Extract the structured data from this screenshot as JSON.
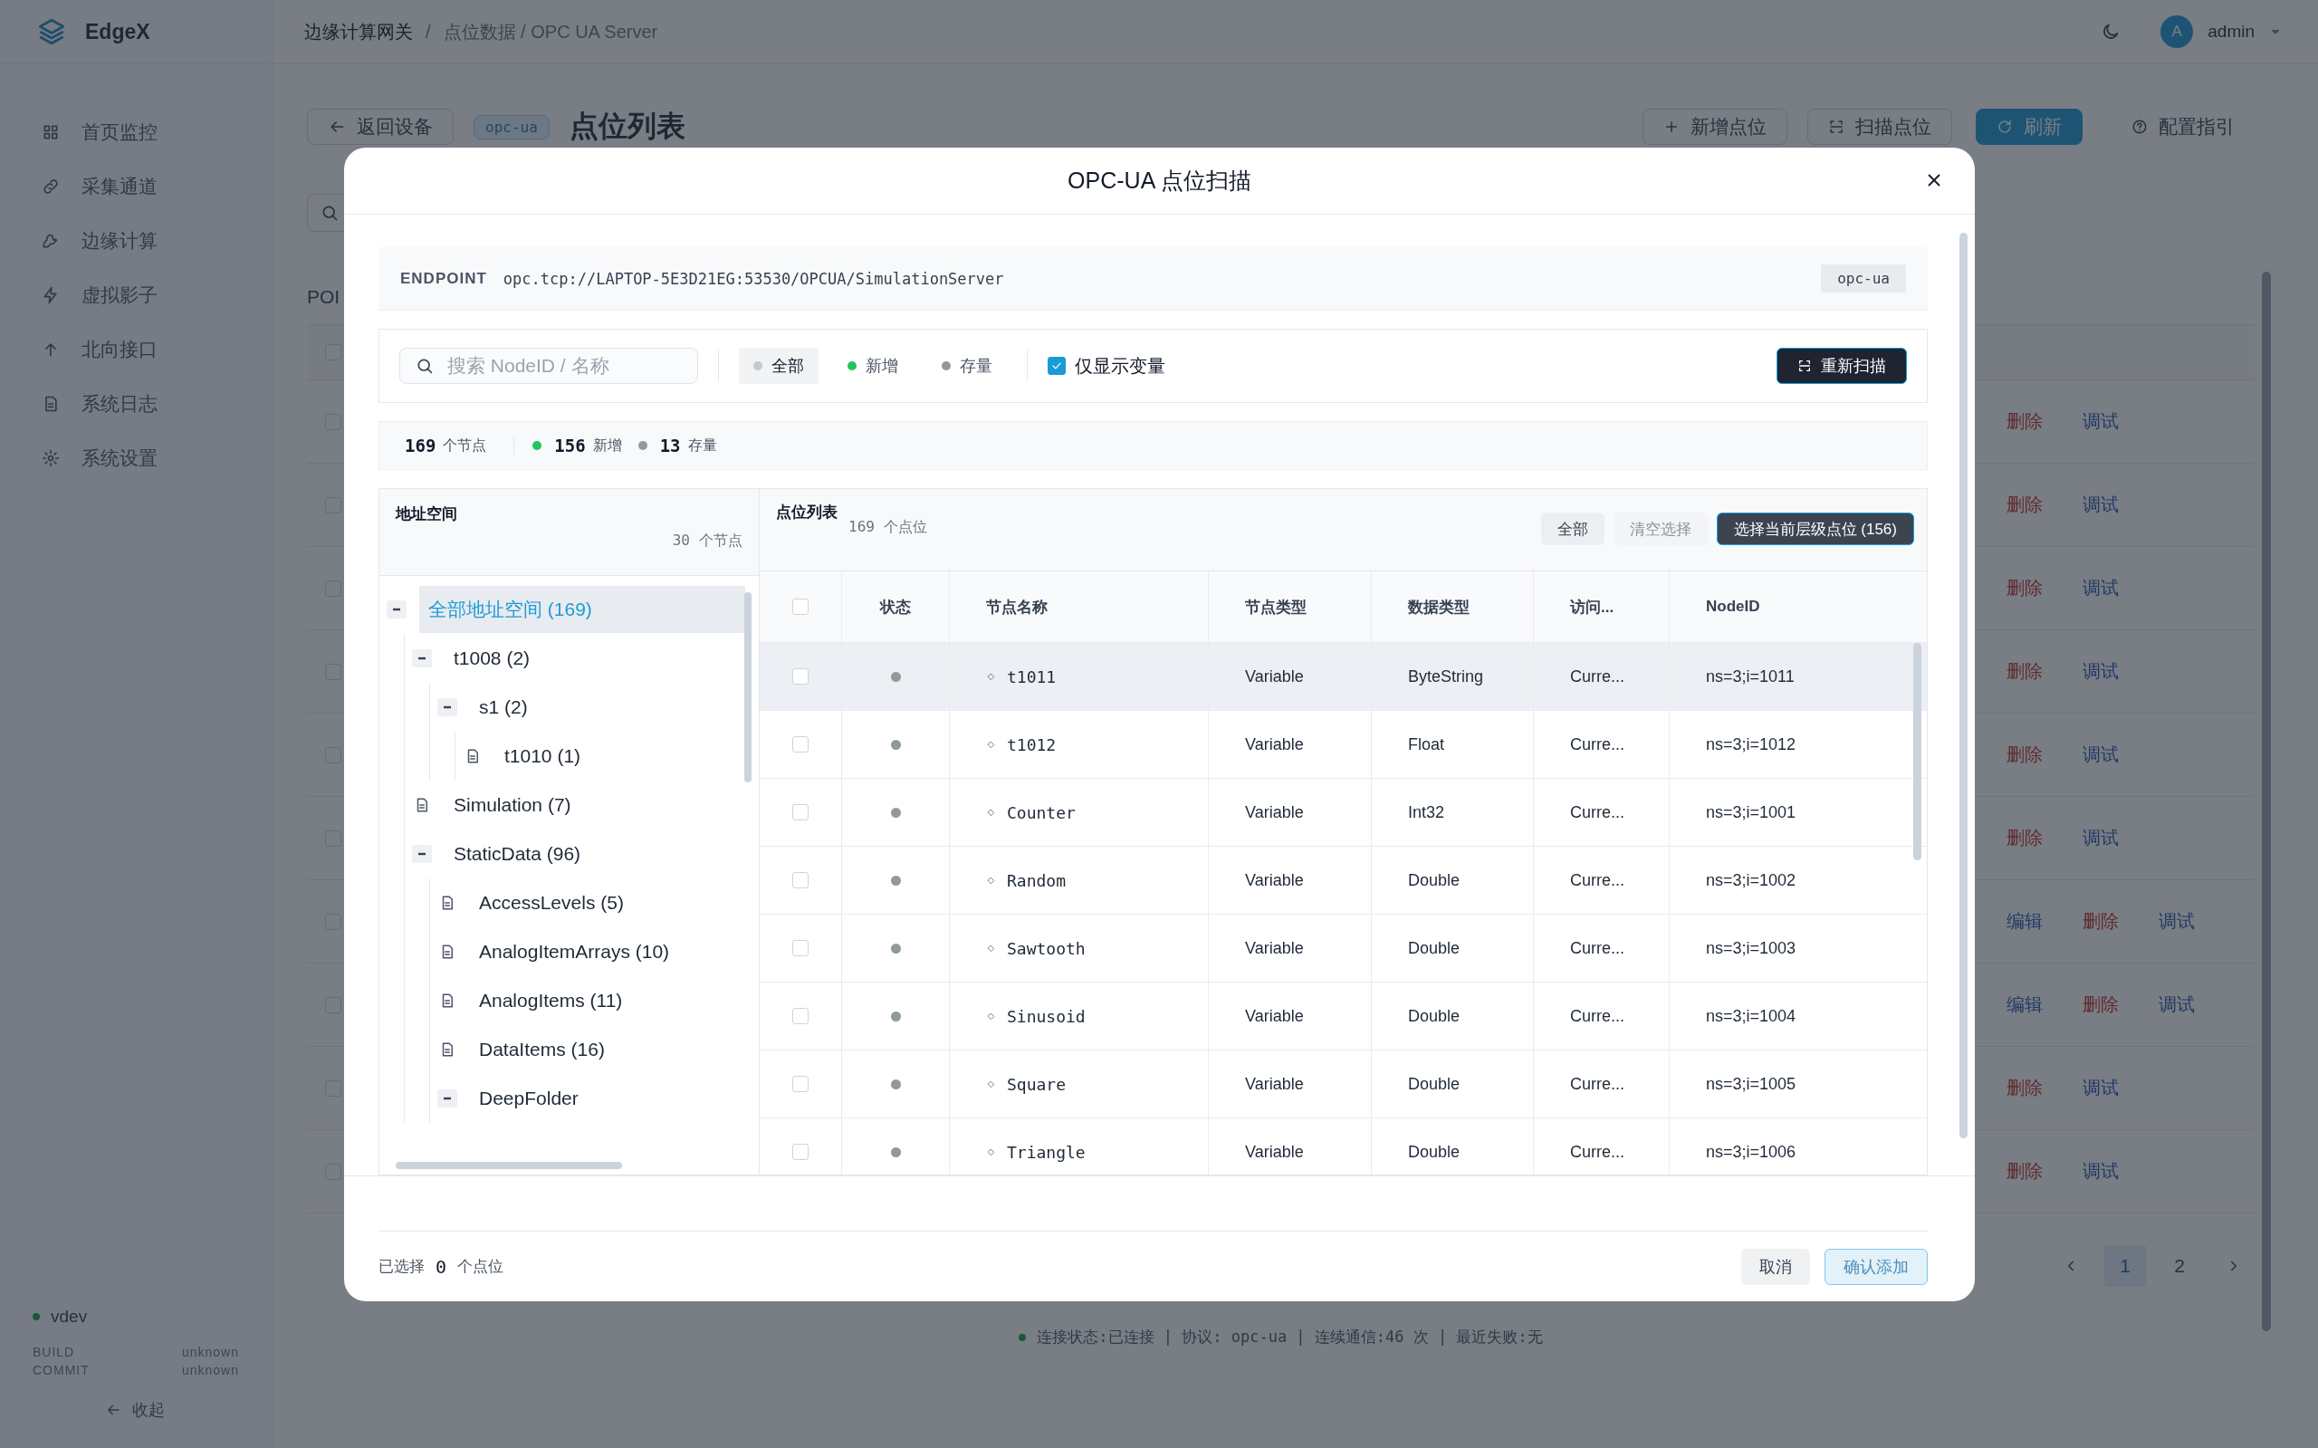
{
  "app": {
    "brand": "EdgeX"
  },
  "header": {
    "breadcrumb": [
      "边缘计算网关",
      "点位数据 / OPC UA Server"
    ],
    "breadcrumb_separator": "/",
    "user": {
      "avatar": "A",
      "name": "admin"
    }
  },
  "sidebar": {
    "items": [
      {
        "label": "首页监控",
        "selected": false
      },
      {
        "label": "采集通道",
        "selected": false
      },
      {
        "label": "边缘计算",
        "selected": false
      },
      {
        "label": "虚拟影子",
        "selected": false
      },
      {
        "label": "北向接口",
        "selected": false
      },
      {
        "label": "系统日志",
        "selected": false
      },
      {
        "label": "系统设置",
        "selected": false
      }
    ],
    "version": "vdev",
    "build": [
      {
        "label": "BUILD",
        "value": "unknown"
      },
      {
        "label": "COMMIT",
        "value": "unknown"
      }
    ],
    "collapse": "收起"
  },
  "page": {
    "back": "返回设备",
    "protocol_tag": "opc-ua",
    "title": "点位列表",
    "actions": [
      {
        "label": "新增点位",
        "kind": "add"
      },
      {
        "label": "扫描点位",
        "kind": "scan"
      },
      {
        "label": "刷新",
        "kind": "refresh"
      },
      {
        "label": "配置指引",
        "kind": "help"
      }
    ],
    "section_label": "POI",
    "table": {
      "all_checked": false,
      "rows": [
        {
          "checked": false,
          "actions": [
            {
              "label": "删除",
              "kind": "danger"
            },
            {
              "label": "调试",
              "kind": "link"
            }
          ]
        },
        {
          "checked": false,
          "actions": [
            {
              "label": "删除",
              "kind": "danger"
            },
            {
              "label": "调试",
              "kind": "link"
            }
          ]
        },
        {
          "checked": false,
          "actions": [
            {
              "label": "删除",
              "kind": "danger"
            },
            {
              "label": "调试",
              "kind": "link"
            }
          ]
        },
        {
          "checked": false,
          "actions": [
            {
              "label": "删除",
              "kind": "danger"
            },
            {
              "label": "调试",
              "kind": "link"
            }
          ]
        },
        {
          "checked": false,
          "actions": [
            {
              "label": "删除",
              "kind": "danger"
            },
            {
              "label": "调试",
              "kind": "link"
            }
          ]
        },
        {
          "checked": false,
          "actions": [
            {
              "label": "删除",
              "kind": "danger"
            },
            {
              "label": "调试",
              "kind": "link"
            }
          ]
        },
        {
          "checked": false,
          "actions": [
            {
              "label": "编辑",
              "kind": "link"
            },
            {
              "label": "删除",
              "kind": "danger"
            },
            {
              "label": "调试",
              "kind": "link"
            }
          ]
        },
        {
          "checked": false,
          "actions": [
            {
              "label": "编辑",
              "kind": "link"
            },
            {
              "label": "删除",
              "kind": "danger"
            },
            {
              "label": "调试",
              "kind": "link"
            }
          ]
        },
        {
          "checked": false,
          "actions": [
            {
              "label": "删除",
              "kind": "danger"
            },
            {
              "label": "调试",
              "kind": "link"
            }
          ]
        },
        {
          "checked": false,
          "actions": [
            {
              "label": "删除",
              "kind": "danger"
            },
            {
              "label": "调试",
              "kind": "link"
            }
          ]
        }
      ]
    },
    "pagination": [
      {
        "label": "1",
        "selected": true
      },
      {
        "label": "2",
        "selected": false
      }
    ],
    "status_line": "连接状态:已连接 | 协议: opc-ua | 连续通信:46 次 | 最近失败:无"
  },
  "modal": {
    "title": "OPC-UA 点位扫描",
    "endpoint": {
      "label": "ENDPOINT",
      "url": "opc.tcp://LAPTOP-5E3D21EG:53530/OPCUA/SimulationServer",
      "protocol": "opc-ua"
    },
    "search": {
      "placeholder": "搜索 NodeID / 名称"
    },
    "filters": [
      {
        "label": "全部",
        "selected": true,
        "color": "#c4c8cf"
      },
      {
        "label": "新增",
        "selected": false,
        "color": "#22c55e"
      },
      {
        "label": "存量",
        "selected": false,
        "color": "#8f9a9a"
      }
    ],
    "only_variables": {
      "label": "仅显示变量",
      "checked": true
    },
    "rescan": "重新扫描",
    "stats": {
      "total": "169",
      "total_unit": "个节点",
      "items": [
        {
          "value": "156",
          "label": "新增",
          "color": "#22c55e"
        },
        {
          "value": "13",
          "label": "存量",
          "color": "#8f9a9a"
        }
      ]
    },
    "tree": {
      "title": "地址空间",
      "count": "30",
      "count_unit": "个节点",
      "nodes": [
        {
          "label": "全部地址空间 (169)",
          "expanded": true,
          "selected": true,
          "children": [
            {
              "label": "t1008 (2)",
              "expanded": true,
              "selected": false,
              "children": [
                {
                  "label": "s1 (2)",
                  "expanded": true,
                  "selected": false,
                  "children": [
                    {
                      "label": "t1010 (1)",
                      "selected": false
                    }
                  ]
                }
              ]
            },
            {
              "label": "Simulation (7)",
              "selected": false
            },
            {
              "label": "StaticData (96)",
              "expanded": true,
              "selected": false,
              "children": [
                {
                  "label": "AccessLevels (5)",
                  "selected": false
                },
                {
                  "label": "AnalogItemArrays (10)",
                  "selected": false
                },
                {
                  "label": "AnalogItems (11)",
                  "selected": false
                },
                {
                  "label": "DataItems (16)",
                  "selected": false
                },
                {
                  "label": "DeepFolder",
                  "expanded": true,
                  "selected": false
                }
              ]
            }
          ]
        }
      ]
    },
    "table": {
      "title": "点位列表",
      "count": "169",
      "count_unit": "个点位",
      "buttons": [
        {
          "label": "全部",
          "kind": "secondary"
        },
        {
          "label": "清空选择",
          "kind": "disabled"
        },
        {
          "label": "选择当前层级点位 (156)",
          "kind": "primary"
        }
      ],
      "all_checked": false,
      "columns": [
        "状态",
        "节点名称",
        "节点类型",
        "数据类型",
        "访问...",
        "NodeID"
      ],
      "rows": [
        {
          "checked": false,
          "hovered": true,
          "color": "#8f9a9a",
          "name": "t1011",
          "node_type": "Variable",
          "data_type": "ByteString",
          "access": "Curre...",
          "node_id": "ns=3;i=1011"
        },
        {
          "checked": false,
          "hovered": false,
          "color": "#8f9a9a",
          "name": "t1012",
          "node_type": "Variable",
          "data_type": "Float",
          "access": "Curre...",
          "node_id": "ns=3;i=1012"
        },
        {
          "checked": false,
          "hovered": false,
          "color": "#8f9a9a",
          "name": "Counter",
          "node_type": "Variable",
          "data_type": "Int32",
          "access": "Curre...",
          "node_id": "ns=3;i=1001"
        },
        {
          "checked": false,
          "hovered": false,
          "color": "#8f9a9a",
          "name": "Random",
          "node_type": "Variable",
          "data_type": "Double",
          "access": "Curre...",
          "node_id": "ns=3;i=1002"
        },
        {
          "checked": false,
          "hovered": false,
          "color": "#8f9a9a",
          "name": "Sawtooth",
          "node_type": "Variable",
          "data_type": "Double",
          "access": "Curre...",
          "node_id": "ns=3;i=1003"
        },
        {
          "checked": false,
          "hovered": false,
          "color": "#8f9a9a",
          "name": "Sinusoid",
          "node_type": "Variable",
          "data_type": "Double",
          "access": "Curre...",
          "node_id": "ns=3;i=1004"
        },
        {
          "checked": false,
          "hovered": false,
          "color": "#8f9a9a",
          "name": "Square",
          "node_type": "Variable",
          "data_type": "Double",
          "access": "Curre...",
          "node_id": "ns=3;i=1005"
        },
        {
          "checked": false,
          "hovered": false,
          "color": "#8f9a9a",
          "name": "Triangle",
          "node_type": "Variable",
          "data_type": "Double",
          "access": "Curre...",
          "node_id": "ns=3;i=1006"
        }
      ]
    },
    "footer": {
      "selected_label": "已选择",
      "selected_count": "0",
      "selected_unit": "个点位",
      "cancel": "取消",
      "confirm": {
        "label": "确认添加",
        "disabled": true
      }
    }
  }
}
